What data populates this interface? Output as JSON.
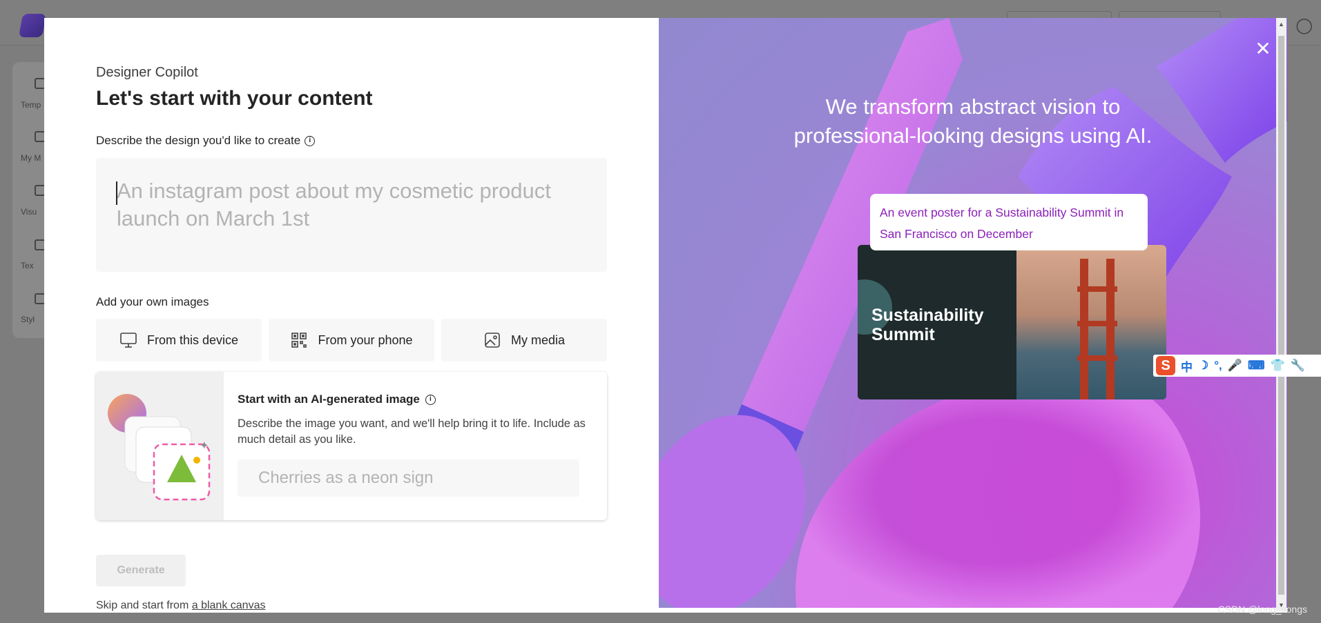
{
  "modal": {
    "subtitle": "Designer Copilot",
    "title": "Let's start with your content",
    "describe_label": "Describe the design you'd like to create",
    "prompt_placeholder": "An instagram post about my cosmetic product launch on March 1st",
    "images_label": "Add your own images",
    "image_buttons": [
      {
        "label": "From this device",
        "icon": "monitor-icon"
      },
      {
        "label": "From your phone",
        "icon": "qr-code-icon"
      },
      {
        "label": "My media",
        "icon": "image-icon"
      }
    ],
    "ai_card": {
      "title": "Start with an AI-generated image",
      "description": "Describe the image you want, and we'll help bring it to life. Include as much detail as you like.",
      "input_placeholder": "Cherries as a neon sign"
    },
    "generate_label": "Generate",
    "skip_text": "Skip and start from",
    "skip_link": "a blank canvas"
  },
  "promo": {
    "headline_line1": "We transform abstract vision to",
    "headline_line2": "professional-looking designs using AI.",
    "bubble_text": "An event poster for a Sustainability Summit in San Francisco on December",
    "poster_title_line1": "Sustainability",
    "poster_title_line2": "Summit",
    "close_icon": "close-icon"
  },
  "background": {
    "sidebar_items": [
      "Temp",
      "My M",
      "Visu",
      "Tex",
      "Styl"
    ]
  },
  "ime": {
    "logo": "S",
    "items": [
      "中",
      "☽",
      "°,",
      "🎤",
      "⌨",
      "👕",
      "🔧"
    ]
  },
  "watermark": "CSDN @long_songs",
  "colors": {
    "accent_purple": "#8b1fb8",
    "promo_bg": "#9a86d4"
  }
}
